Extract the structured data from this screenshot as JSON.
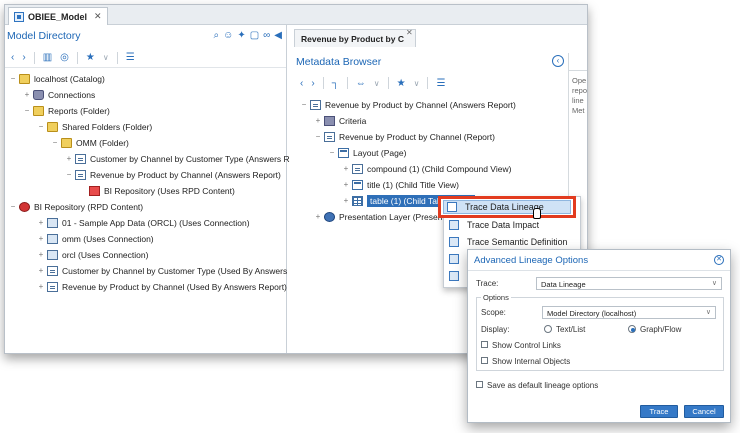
{
  "document_tab": {
    "label": "OBIEE_Model",
    "close": "✕"
  },
  "model_directory": {
    "title": "Model Directory",
    "tree": [
      {
        "label": "localhost (Catalog)",
        "icon": "folder"
      },
      {
        "label": "Connections",
        "icon": "database"
      },
      {
        "label": "Reports (Folder)",
        "icon": "folder"
      },
      {
        "label": "Shared Folders (Folder)",
        "icon": "folder"
      },
      {
        "label": "OMM (Folder)",
        "icon": "folder"
      },
      {
        "label": "Customer by Channel by Customer Type (Answers R",
        "icon": "report"
      },
      {
        "label": "Revenue by Product by Channel (Answers Report)",
        "icon": "report"
      },
      {
        "label": "BI Repository (Uses RPD Content)",
        "icon": "rpd"
      },
      {
        "label": "BI Repository (RPD Content)",
        "icon": "rpd"
      },
      {
        "label": "01 - Sample App Data (ORCL) (Uses Connection)",
        "icon": "connection"
      },
      {
        "label": "omm (Uses Connection)",
        "icon": "connection"
      },
      {
        "label": "orcl (Uses Connection)",
        "icon": "connection"
      },
      {
        "label": "Customer by Channel by Customer Type (Used By Answers",
        "icon": "report"
      },
      {
        "label": "Revenue by Product by Channel (Used By Answers Report)",
        "icon": "report"
      }
    ]
  },
  "content_tab": {
    "label": "Revenue by Product by C",
    "close": "✕"
  },
  "metadata_browser": {
    "title": "Metadata Browser",
    "tree": [
      {
        "label": "Revenue by Product by Channel (Answers Report)"
      },
      {
        "label": "Criteria"
      },
      {
        "label": "Revenue by Product by Channel (Report)"
      },
      {
        "label": "Layout (Page)"
      },
      {
        "label": "compound (1) (Child Compound View)"
      },
      {
        "label": "title (1) (Child Title View)"
      },
      {
        "label": "table (1) (Child Table View)"
      },
      {
        "label": "Presentation Layer (Presenta"
      }
    ]
  },
  "side_pane_text": [
    "Ope",
    "repo",
    "line",
    "Met"
  ],
  "context_menu": {
    "items": [
      "Trace Data Lineage",
      "Trace Data Impact",
      "Trace Semantic Definition"
    ]
  },
  "dialog": {
    "title": "Advanced Lineage Options",
    "trace_label": "Trace:",
    "trace_value": "Data Lineage",
    "options_legend": "Options",
    "scope_label": "Scope:",
    "scope_value": "Model Directory (localhost)",
    "display_label": "Display:",
    "display_option_1": "Text/List",
    "display_option_2": "Graph/Flow",
    "display_selected": "Graph/Flow",
    "show_control_links": "Show Control Links",
    "show_internal_objects": "Show Internal Objects",
    "save_default": "Save as default lineage options",
    "trace_button": "Trace",
    "cancel_button": "Cancel"
  },
  "colors": {
    "accent": "#1c66b5",
    "highlight_border": "#e23b1f",
    "selection": "#2e6fb8",
    "button": "#3579c7"
  }
}
